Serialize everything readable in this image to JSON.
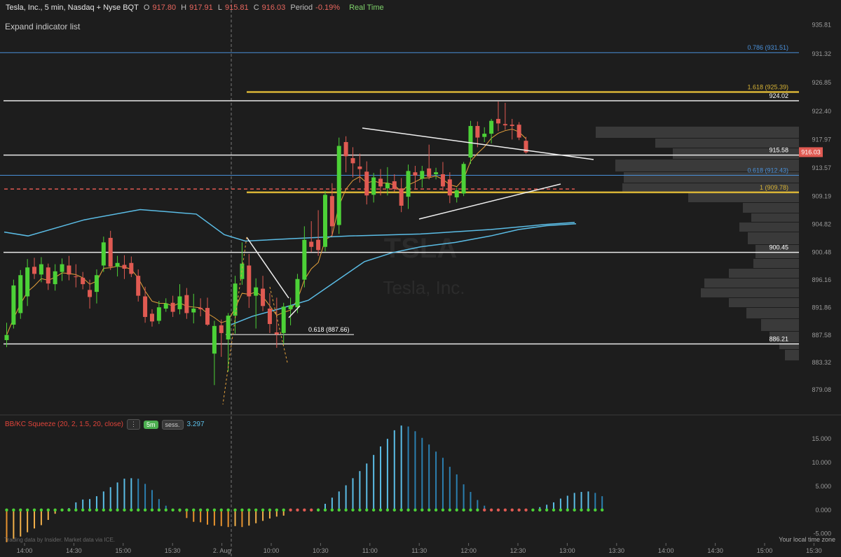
{
  "header": {
    "title": "Tesla, Inc., 5 min, Nasdaq + Nyse BQT",
    "o_label": "O",
    "o_value": "917.80",
    "h_label": "H",
    "h_value": "917.91",
    "l_label": "L",
    "l_value": "915.81",
    "c_label": "C",
    "c_value": "916.03",
    "period_label": "Period",
    "period_value": "-0.19%",
    "realtime": "Real Time"
  },
  "expand_label": "Expand indicator list",
  "watermark": {
    "symbol": "TSLA",
    "name": "Tesla, Inc."
  },
  "indicator": {
    "name": "BB/KC Squeeze (20, 2, 1.5, 20, close)",
    "menu": "⋮",
    "timeframe": "5m",
    "session": "sess.",
    "value": "3.297"
  },
  "footer": {
    "left": "Trading data by Insider. Market data via ICE.",
    "right": "Your local time zone"
  },
  "colors": {
    "up": "#4cd137",
    "down": "#e05a52",
    "ema": "#e8a33d",
    "sma": "#5bbde6",
    "bg": "#1d1d1d",
    "fib": "#4a90d9",
    "gold": "#d8b436",
    "price_badge": "#e05a52"
  },
  "chart_data": {
    "type": "candlestick",
    "title": "Tesla, Inc., 5 min, Nasdaq + Nyse BQT",
    "ylim": [
      876.9,
      937.3
    ],
    "y_ticks": [
      "935.81",
      "931.32",
      "926.85",
      "922.40",
      "917.97",
      "913.57",
      "909.19",
      "904.82",
      "900.48",
      "896.16",
      "891.86",
      "887.58",
      "883.32",
      "879.08"
    ],
    "x_ticks": [
      "14:00",
      "14:30",
      "15:00",
      "15:30",
      "2. Aug",
      "10:00",
      "10:30",
      "11:00",
      "11:30",
      "12:00",
      "12:30",
      "13:00",
      "13:30",
      "14:00",
      "14:30",
      "15:00",
      "15:30"
    ],
    "current_price": "916.03",
    "level_lines": [
      {
        "label": "924.02",
        "value": 924.02,
        "color": "#ffffff"
      },
      {
        "label": "915.58",
        "value": 915.58,
        "color": "#ffffff"
      },
      {
        "label": "900.45",
        "value": 900.45,
        "color": "#ffffff"
      },
      {
        "label": "886.21",
        "value": 886.21,
        "color": "#ffffff"
      }
    ],
    "fib_lines": [
      {
        "label": "0.786 (931.51)",
        "value": 931.51,
        "color": "#4a90d9"
      },
      {
        "label": "1.618 (925.39)",
        "value": 925.39,
        "color": "#d8b436"
      },
      {
        "label": "0.618 (912.43)",
        "value": 912.43,
        "color": "#4a90d9"
      },
      {
        "label": "1 (909.78)",
        "value": 909.78,
        "color": "#d8b436"
      },
      {
        "label": "0.618 (887.66)",
        "value": 887.66,
        "color": "#ffffff"
      }
    ],
    "dashed_level": 910.3,
    "candles": [
      [
        886.8,
        889.5,
        885.7,
        887.6
      ],
      [
        889.2,
        896.2,
        888.6,
        895.3
      ],
      [
        891.0,
        897.7,
        890.1,
        896.9
      ],
      [
        893.6,
        899.4,
        892.1,
        898.1
      ],
      [
        898.2,
        899.6,
        896.3,
        897.1
      ],
      [
        897.0,
        899.7,
        895.8,
        898.6
      ],
      [
        898.1,
        898.7,
        894.6,
        895.6
      ],
      [
        895.5,
        898.6,
        894.5,
        897.5
      ],
      [
        897.4,
        899.5,
        896.0,
        898.6
      ],
      [
        898.4,
        899.9,
        896.1,
        897.0
      ],
      [
        896.7,
        898.6,
        895.0,
        896.6
      ],
      [
        896.5,
        897.4,
        894.7,
        895.5
      ],
      [
        894.6,
        896.2,
        891.7,
        893.5
      ],
      [
        894.3,
        897.8,
        892.5,
        896.9
      ],
      [
        898.4,
        902.9,
        897.4,
        902.0
      ],
      [
        902.7,
        903.8,
        897.7,
        898.2
      ],
      [
        898.2,
        899.9,
        896.7,
        898.8
      ],
      [
        898.5,
        900.0,
        896.3,
        897.9
      ],
      [
        898.8,
        899.8,
        896.6,
        897.1
      ],
      [
        896.8,
        897.8,
        892.8,
        893.7
      ],
      [
        893.6,
        895.1,
        889.5,
        890.4
      ],
      [
        890.9,
        891.6,
        888.9,
        889.7
      ],
      [
        889.8,
        892.9,
        889.3,
        891.9
      ],
      [
        891.7,
        893.3,
        891.2,
        892.5
      ],
      [
        892.6,
        893.7,
        890.4,
        891.2
      ],
      [
        891.6,
        895.5,
        890.8,
        893.6
      ],
      [
        893.8,
        894.9,
        890.1,
        891.0
      ],
      [
        891.1,
        894.0,
        889.4,
        891.7
      ],
      [
        891.8,
        893.3,
        890.5,
        891.6
      ],
      [
        891.8,
        893.4,
        889.0,
        889.2
      ],
      [
        884.7,
        889.8,
        879.8,
        889.0
      ],
      [
        889.1,
        890.0,
        884.2,
        887.9
      ],
      [
        886.9,
        891.0,
        881.9,
        890.6
      ],
      [
        890.6,
        896.8,
        887.8,
        895.6
      ],
      [
        896.3,
        902.0,
        895.4,
        898.7
      ],
      [
        898.4,
        900.2,
        891.8,
        893.6
      ],
      [
        893.7,
        896.4,
        888.6,
        895.0
      ],
      [
        894.8,
        896.8,
        891.3,
        892.1
      ],
      [
        891.7,
        894.1,
        887.9,
        889.3
      ],
      [
        888.0,
        893.4,
        885.6,
        887.7
      ],
      [
        887.9,
        892.6,
        886.2,
        892.0
      ],
      [
        891.6,
        893.4,
        889.1,
        892.2
      ],
      [
        891.9,
        897.1,
        891.0,
        896.3
      ],
      [
        896.2,
        904.5,
        895.0,
        902.4
      ],
      [
        902.1,
        905.3,
        900.5,
        901.3
      ],
      [
        902.4,
        907.0,
        899.9,
        900.8
      ],
      [
        901.3,
        910.0,
        900.6,
        909.4
      ],
      [
        909.2,
        911.2,
        902.9,
        904.5
      ],
      [
        904.7,
        918.3,
        903.3,
        917.0
      ],
      [
        917.6,
        918.5,
        912.9,
        915.4
      ],
      [
        915.1,
        916.8,
        912.1,
        914.3
      ],
      [
        913.8,
        915.8,
        911.3,
        913.4
      ],
      [
        913.0,
        914.6,
        907.9,
        909.3
      ],
      [
        909.4,
        912.8,
        908.2,
        912.1
      ],
      [
        911.9,
        913.4,
        909.3,
        910.7
      ],
      [
        910.4,
        913.7,
        909.3,
        911.2
      ],
      [
        911.5,
        912.6,
        909.9,
        910.3
      ],
      [
        910.4,
        912.0,
        906.7,
        907.7
      ],
      [
        909.1,
        914.1,
        907.2,
        913.1
      ],
      [
        912.9,
        913.9,
        910.4,
        912.4
      ],
      [
        911.9,
        913.9,
        910.5,
        913.1
      ],
      [
        913.5,
        917.2,
        911.8,
        912.2
      ],
      [
        912.6,
        913.6,
        911.8,
        912.9
      ],
      [
        912.6,
        914.5,
        910.1,
        910.7
      ],
      [
        911.8,
        912.9,
        908.1,
        909.3
      ],
      [
        909.0,
        910.5,
        908.2,
        910.1
      ],
      [
        909.6,
        914.5,
        909.2,
        914.2
      ],
      [
        915.2,
        920.9,
        914.2,
        920.1
      ],
      [
        920.1,
        920.8,
        916.8,
        918.3
      ],
      [
        918.4,
        919.9,
        917.6,
        918.9
      ],
      [
        918.9,
        921.2,
        917.4,
        920.9
      ],
      [
        921.2,
        923.9,
        919.3,
        920.5
      ],
      [
        920.4,
        923.7,
        919.5,
        920.2
      ],
      [
        920.3,
        921.2,
        918.0,
        920.1
      ],
      [
        920.3,
        920.7,
        917.9,
        918.3
      ],
      [
        917.8,
        918.4,
        915.8,
        916.0
      ]
    ],
    "squeeze_histogram": [
      -6.8,
      -6.1,
      -5.6,
      -4.7,
      -3.9,
      -3.2,
      -2.1,
      -0.8,
      0.0,
      0.4,
      1.6,
      2.2,
      2.3,
      2.9,
      3.9,
      4.8,
      5.8,
      6.6,
      6.7,
      6.6,
      5.5,
      4.2,
      2.3,
      0.9,
      0.0,
      -0.4,
      -1.7,
      -2.5,
      -2.6,
      -3.1,
      -3.3,
      -3.4,
      -3.6,
      -3.4,
      -3.6,
      -3.3,
      -2.8,
      -2.3,
      -1.8,
      -1.4,
      -1.2,
      -0.1,
      0.0,
      0.1,
      0.1,
      0.3,
      1.3,
      2.6,
      3.9,
      5.2,
      6.7,
      8.2,
      9.8,
      11.6,
      13.4,
      15.0,
      16.8,
      17.8,
      17.6,
      16.6,
      15.2,
      13.8,
      12.3,
      11.0,
      9.1,
      7.5,
      5.4,
      3.8,
      2.1,
      0.9,
      0.1,
      0.0,
      0.0,
      0.0,
      0.0,
      0.0,
      0.1,
      0.6,
      1.1,
      1.6,
      2.4,
      3.0,
      3.6,
      3.8,
      3.9,
      3.6,
      2.9
    ],
    "squeeze_ylim": [
      -8,
      19
    ],
    "squeeze_ticks": [
      "15.000",
      "10.000",
      "5.000",
      "0.000",
      "-5.000"
    ]
  }
}
